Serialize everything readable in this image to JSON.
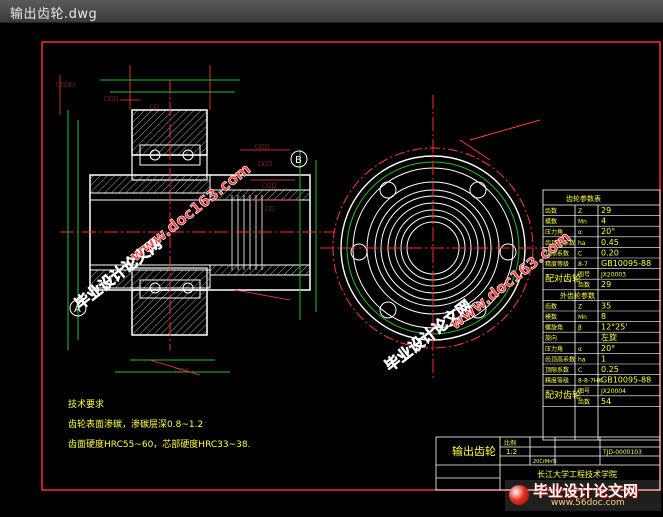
{
  "window": {
    "title": "输出齿轮.dwg"
  },
  "drawing": {
    "section_labels": {
      "A": "A",
      "B": "B"
    },
    "tech_req": {
      "heading": "技术要求",
      "line1": "齿轮表面渗碳，渗碳层深0.8~1.2",
      "line2": "齿面硬度HRC55~60，芯部硬度HRC33~38."
    },
    "gear_table": {
      "title": "齿轮参数表",
      "rows1": [
        {
          "k": "齿数",
          "s": "Z",
          "v": "29"
        },
        {
          "k": "模数",
          "s": "Mn",
          "v": "4"
        },
        {
          "k": "压力角",
          "s": "α",
          "v": "20°"
        },
        {
          "k": "齿顶高系数",
          "s": "ha",
          "v": "0.45"
        },
        {
          "k": "顶隙系数",
          "s": "C",
          "v": "0.20"
        },
        {
          "k": "精度等级",
          "s": "8-7",
          "v": "GB10095-88"
        }
      ],
      "mate": {
        "label": "配对齿轮",
        "r1k": "图号",
        "r1v": "JX20003",
        "r2k": "齿数",
        "r2v": "29"
      },
      "sect2": "外齿轮参数",
      "rows2": [
        {
          "k": "齿数",
          "s": "Z",
          "v": "35"
        },
        {
          "k": "模数",
          "s": "Mn",
          "v": "8"
        },
        {
          "k": "螺旋角",
          "s": "β",
          "v": "12°25'"
        },
        {
          "k": "旋向",
          "s": "",
          "v": "左旋"
        },
        {
          "k": "压力角",
          "s": "α",
          "v": "20°"
        },
        {
          "k": "齿顶高系数",
          "s": "ha",
          "v": "1"
        },
        {
          "k": "顶隙系数",
          "s": "C",
          "v": "0.25"
        },
        {
          "k": "精度等级",
          "s": "8-8-7HK",
          "v": "GB10095-88"
        }
      ],
      "mate2": {
        "label": "配对齿轮",
        "r1k": "图号",
        "r1v": "JX20004",
        "r2k": "齿数",
        "r2v": "54"
      }
    },
    "title_block": {
      "name": "输出齿轮",
      "scale_label": "比例",
      "scale": "1:2",
      "material": "20CrMnTi",
      "drawing_no": "TJD-0000103",
      "school": "长江大学工程技术学院"
    },
    "watermarks": {
      "cn": "毕业设计论文网",
      "url": "www.doc163.com"
    },
    "logo": {
      "cn": "毕业设计论文网",
      "url": "www.56doc.com"
    }
  },
  "colors": {
    "outline": "#ffffff",
    "border": "#ff2a2a",
    "center": "#ff2a2a",
    "dim": "#ff3b3b",
    "green": "#22c22b",
    "hatch": "#b0b0b0",
    "hidden": "#00c8ff",
    "watermark": "#ff3b3b",
    "text": "#ffff40"
  }
}
